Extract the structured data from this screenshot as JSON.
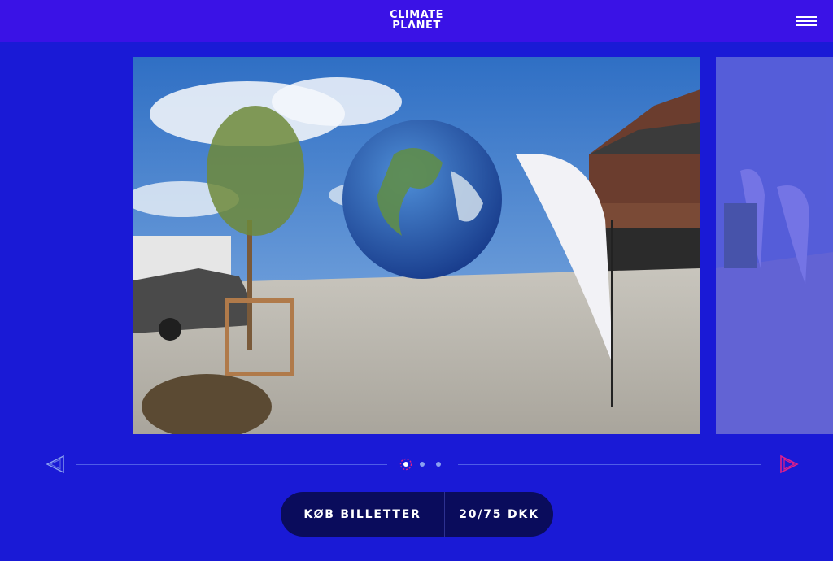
{
  "header": {
    "logo_line1": "CLIMATE",
    "logo_line2": "PLΛNET",
    "menu_icon": "hamburger-menu-icon"
  },
  "carousel": {
    "current_slide": 1,
    "slide_count": 3,
    "prev_icon": "triangle-arrow-left-icon",
    "next_icon": "triangle-arrow-right-icon"
  },
  "cta": {
    "buy_label": "KØB BILLETTER",
    "price_label": "20/75 DKK"
  },
  "colors": {
    "page_background": "#1a1ad6",
    "header_background": "#3a12e6",
    "cta_background": "#0a0c5c",
    "accent_pink": "#e0208a"
  }
}
